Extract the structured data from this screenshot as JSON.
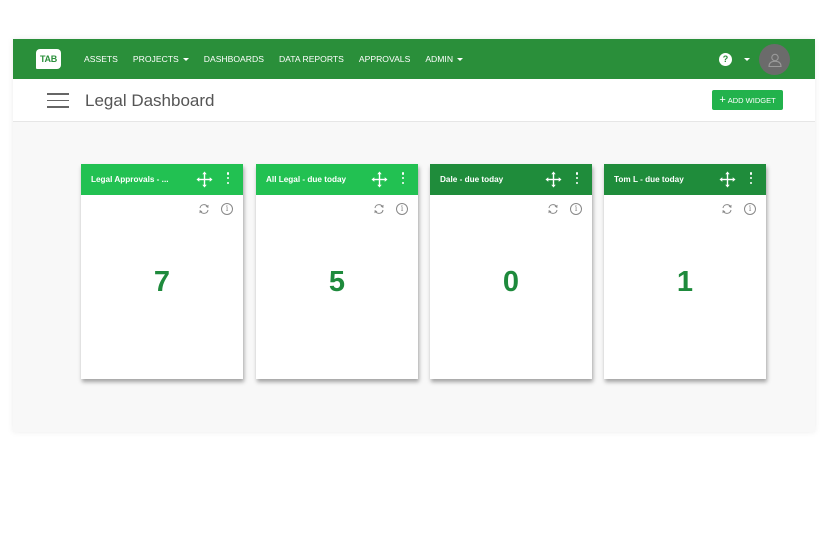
{
  "nav": {
    "logo": "TAB",
    "items": [
      {
        "label": "ASSETS",
        "dropdown": false
      },
      {
        "label": "PROJECTS",
        "dropdown": true
      },
      {
        "label": "DASHBOARDS",
        "dropdown": false
      },
      {
        "label": "DATA REPORTS",
        "dropdown": false
      },
      {
        "label": "APPROVALS",
        "dropdown": false
      },
      {
        "label": "ADMIN",
        "dropdown": true
      }
    ],
    "help_label": "?"
  },
  "header": {
    "title": "Legal Dashboard",
    "add_widget_label": "ADD WIDGET",
    "add_widget_plus": "+"
  },
  "widgets": [
    {
      "title": "Legal Approvals - ...",
      "value": "7",
      "style": "light"
    },
    {
      "title": "All Legal - due today",
      "value": "5",
      "style": "light"
    },
    {
      "title": "Dale - due today",
      "value": "0",
      "style": "dark"
    },
    {
      "title": "Tom L - due today",
      "value": "1",
      "style": "dark"
    }
  ],
  "info_glyph": "i",
  "colors": {
    "navbar": "#2a8f3a",
    "widget_header_light": "#22c152",
    "widget_header_dark": "#1f8c3b",
    "value_text": "#1e8a3c",
    "add_widget_button": "#22b24c"
  },
  "icons": [
    "logo",
    "caret-down-icon",
    "help-icon",
    "user-avatar-icon",
    "hamburger-menu-icon",
    "plus-icon",
    "move-icon",
    "kebab-menu-icon",
    "refresh-icon",
    "info-icon"
  ]
}
